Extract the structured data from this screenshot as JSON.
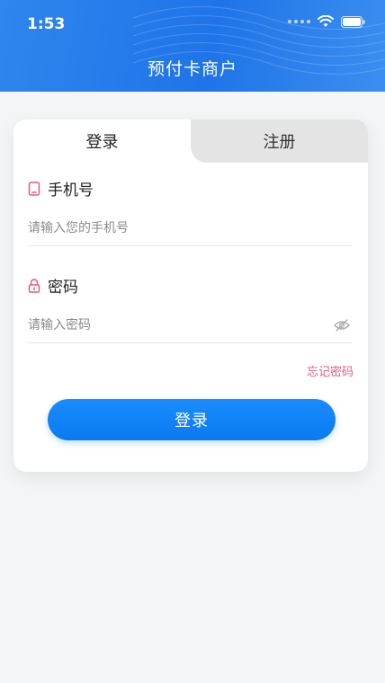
{
  "status_bar": {
    "time": "1:53"
  },
  "header": {
    "title": "预付卡商户"
  },
  "tabs": [
    {
      "label": "登录",
      "active": true
    },
    {
      "label": "注册",
      "active": false
    }
  ],
  "form": {
    "phone": {
      "label": "手机号",
      "placeholder": "请输入您的手机号",
      "value": ""
    },
    "password": {
      "label": "密码",
      "placeholder": "请输入密码",
      "value": ""
    },
    "forgot_label": "忘记密码",
    "submit_label": "登录"
  },
  "colors": {
    "header_blue": "#1f74e8",
    "button_blue": "#0a7af0",
    "accent_pink": "#e45c7a",
    "page_bg": "#f3f5f6"
  },
  "icons": {
    "phone_field": "phone-icon",
    "password_field": "lock-icon",
    "password_toggle": "eye-hidden-icon",
    "wifi": "wifi-icon",
    "battery": "battery-icon"
  }
}
